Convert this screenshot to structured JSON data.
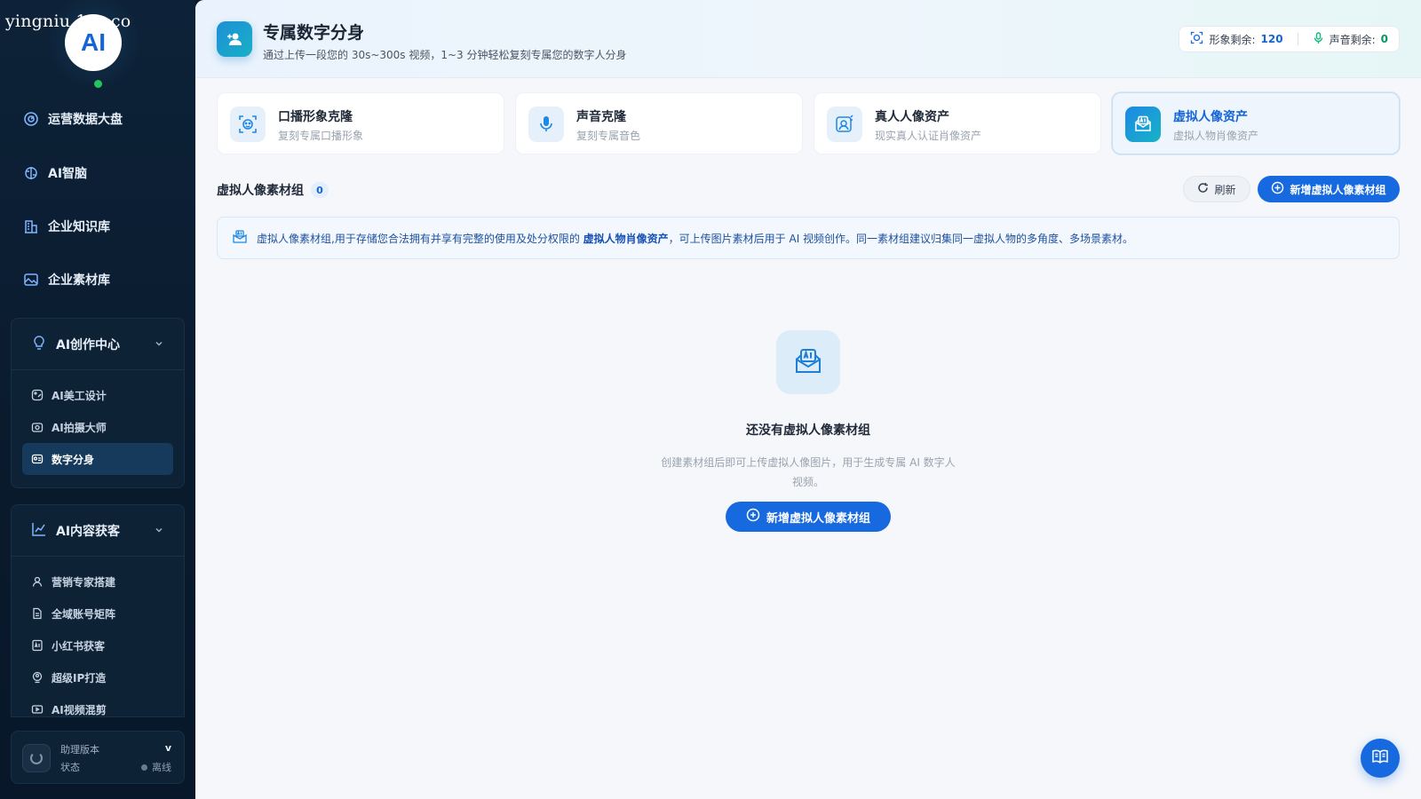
{
  "watermark": "yingniu.10v.co",
  "logo": {
    "text": "AI"
  },
  "sidebar": {
    "items": [
      {
        "label": "运营数据大盘",
        "icon": "dashboard-icon"
      },
      {
        "label": "AI智脑",
        "icon": "brain-icon"
      },
      {
        "label": "企业知识库",
        "icon": "building-icon"
      },
      {
        "label": "企业素材库",
        "icon": "image-icon"
      }
    ],
    "groups": [
      {
        "label": "AI创作中心",
        "icon": "bulb-icon",
        "items": [
          {
            "label": "AI美工设计",
            "icon": "palette-icon"
          },
          {
            "label": "AI拍摄大师",
            "icon": "camera-icon"
          },
          {
            "label": "数字分身",
            "icon": "id-card-icon",
            "active": true
          }
        ]
      },
      {
        "label": "AI内容获客",
        "icon": "trend-icon",
        "items": [
          {
            "label": "营销专家搭建",
            "icon": "user-icon"
          },
          {
            "label": "全域账号矩阵",
            "icon": "file-icon"
          },
          {
            "label": "小红书获客",
            "icon": "ai-doc-icon"
          },
          {
            "label": "超级IP打造",
            "icon": "ip-icon"
          },
          {
            "label": "AI视频混剪",
            "icon": "video-icon"
          }
        ]
      }
    ],
    "status": {
      "version_label": "助理版本",
      "version_value": "v",
      "status_label": "状态",
      "status_value": "离线"
    }
  },
  "header": {
    "title": "专属数字分身",
    "subtitle": "通过上传一段您的 30s~300s 视频，1~3 分钟轻松复刻专属您的数字人分身",
    "quota": {
      "image_label": "形象剩余:",
      "image_value": "120",
      "voice_label": "声音剩余:",
      "voice_value": "0"
    }
  },
  "tabs": [
    {
      "title": "口播形象克隆",
      "subtitle": "复刻专属口播形象",
      "icon": "face-scan-icon"
    },
    {
      "title": "声音克隆",
      "subtitle": "复刻专属音色",
      "icon": "microphone-icon"
    },
    {
      "title": "真人人像资产",
      "subtitle": "现实真人认证肖像资产",
      "icon": "portrait-icon"
    },
    {
      "title": "虚拟人像资产",
      "subtitle": "虚拟人物肖像资产",
      "icon": "ai-mail-icon",
      "active": true
    }
  ],
  "section": {
    "title": "虚拟人像素材组",
    "count": "0",
    "refresh_label": "刷新",
    "add_label": "新增虚拟人像素材组"
  },
  "info": {
    "text_before": "虚拟人像素材组,用于存储您合法拥有并享有完整的使用及处分权限的",
    "text_bold": "虚拟人物肖像资产",
    "text_after": "，可上传图片素材后用于 AI 视频创作。同一素材组建议归集同一虚拟人物的多角度、多场景素材。"
  },
  "empty": {
    "title": "还没有虚拟人像素材组",
    "desc": "创建素材组后即可上传虚拟人像图片，用于生成专属 AI 数字人视频。",
    "button": "新增虚拟人像素材组"
  },
  "colors": {
    "accent": "#1769e0",
    "sidebar_bg": "#0d2238",
    "online": "#22c55e"
  }
}
